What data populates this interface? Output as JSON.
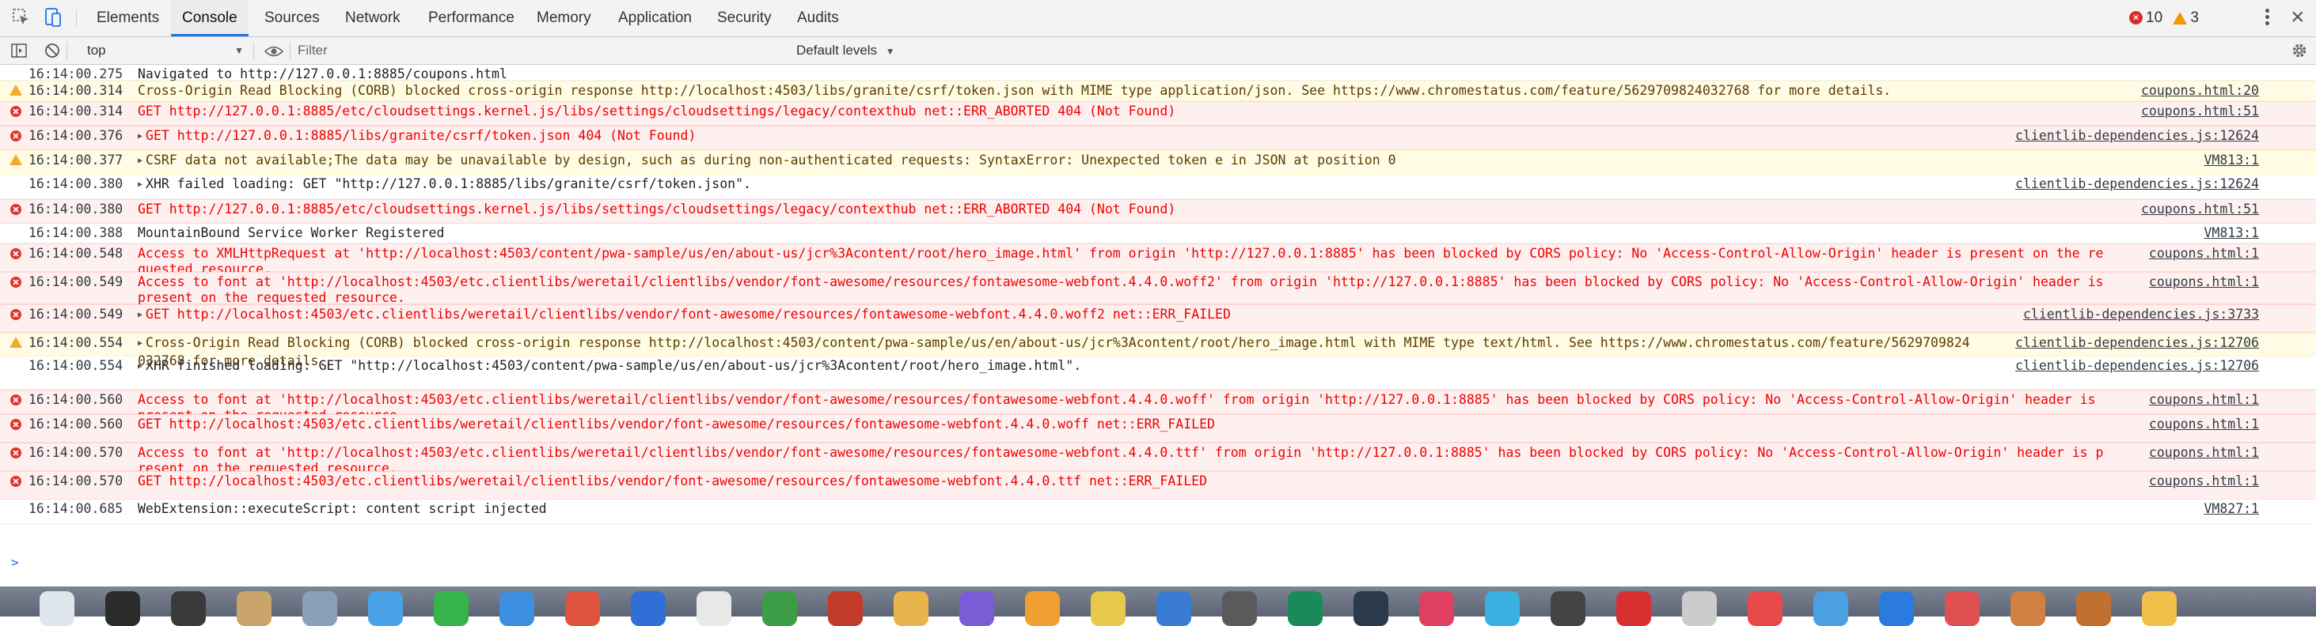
{
  "tabs": [
    {
      "label": "Elements",
      "active": false
    },
    {
      "label": "Console",
      "active": true
    },
    {
      "label": "Sources",
      "active": false
    },
    {
      "label": "Network",
      "active": false
    },
    {
      "label": "Performance",
      "active": false
    },
    {
      "label": "Memory",
      "active": false
    },
    {
      "label": "Application",
      "active": false
    },
    {
      "label": "Security",
      "active": false
    },
    {
      "label": "Audits",
      "active": false
    }
  ],
  "counts": {
    "errors": "10",
    "warnings": "3"
  },
  "toolbar": {
    "context": "top",
    "filter_placeholder": "Filter",
    "levels": "Default levels"
  },
  "messages": [
    {
      "level": "info",
      "time": "16:14:00.275",
      "text": "Navigated to http://127.0.0.1:8885/coupons.html",
      "source": ""
    },
    {
      "level": "warning",
      "time": "16:14:00.314",
      "text": "Cross-Origin Read Blocking (CORB) blocked cross-origin response http://localhost:4503/libs/granite/csrf/token.json with MIME type application/json. See https://www.chromestatus.com/feature/5629709824032768 for more details.",
      "source": "coupons.html:20"
    },
    {
      "level": "error",
      "time": "16:14:00.314",
      "text": "GET http://127.0.0.1:8885/etc/cloudsettings.kernel.js/libs/settings/cloudsettings/legacy/contexthub net::ERR_ABORTED 404 (Not Found)",
      "source": "coupons.html:51"
    },
    {
      "level": "error",
      "time": "16:14:00.376",
      "text": "GET http://127.0.0.1:8885/libs/granite/csrf/token.json 404 (Not Found)",
      "source": "clientlib-dependencies.js:12624",
      "expand": true
    },
    {
      "level": "warning",
      "time": "16:14:00.377",
      "text": "CSRF data not available;The data may be unavailable by design, such as during non-authenticated requests: SyntaxError: Unexpected token e in JSON at position 0",
      "source": "VM813:1",
      "expand": true
    },
    {
      "level": "log",
      "time": "16:14:00.380",
      "text": "XHR failed loading: GET \"http://127.0.0.1:8885/libs/granite/csrf/token.json\".",
      "source": "clientlib-dependencies.js:12624",
      "expand": true
    },
    {
      "level": "error",
      "time": "16:14:00.380",
      "text": "GET http://127.0.0.1:8885/etc/cloudsettings.kernel.js/libs/settings/cloudsettings/legacy/contexthub net::ERR_ABORTED 404 (Not Found)",
      "source": "coupons.html:51"
    },
    {
      "level": "log",
      "time": "16:14:00.388",
      "text": "MountainBound Service Worker Registered",
      "source": "VM813:1"
    },
    {
      "level": "error",
      "time": "16:14:00.548",
      "text": "Access to XMLHttpRequest at 'http://localhost:4503/content/pwa-sample/us/en/about-us/jcr%3Acontent/root/hero_image.html' from origin 'http://127.0.0.1:8885' has been blocked by CORS policy: No 'Access-Control-Allow-Origin' header is present on the requested resource.",
      "source": "coupons.html:1"
    },
    {
      "level": "error",
      "time": "16:14:00.549",
      "text": "Access to font at 'http://localhost:4503/etc.clientlibs/weretail/clientlibs/vendor/font-awesome/resources/fontawesome-webfont.4.4.0.woff2' from origin 'http://127.0.0.1:8885' has been blocked by CORS policy: No 'Access-Control-Allow-Origin' header is present on the requested resource.",
      "source": "coupons.html:1"
    },
    {
      "level": "error",
      "time": "16:14:00.549",
      "text": "GET http://localhost:4503/etc.clientlibs/weretail/clientlibs/vendor/font-awesome/resources/fontawesome-webfont.4.4.0.woff2 net::ERR_FAILED",
      "source": "clientlib-dependencies.js:3733",
      "expand": true
    },
    {
      "level": "warning",
      "time": "16:14:00.554",
      "text": "Cross-Origin Read Blocking (CORB) blocked cross-origin response http://localhost:4503/content/pwa-sample/us/en/about-us/jcr%3Acontent/root/hero_image.html with MIME type text/html. See https://www.chromestatus.com/feature/5629709824032768 for more details.",
      "source": "clientlib-dependencies.js:12706",
      "expand": true
    },
    {
      "level": "log",
      "time": "16:14:00.554",
      "text": "XHR finished loading: GET \"http://localhost:4503/content/pwa-sample/us/en/about-us/jcr%3Acontent/root/hero_image.html\".",
      "source": "clientlib-dependencies.js:12706",
      "expand": true
    },
    {
      "level": "error",
      "time": "16:14:00.560",
      "text": "Access to font at 'http://localhost:4503/etc.clientlibs/weretail/clientlibs/vendor/font-awesome/resources/fontawesome-webfont.4.4.0.woff' from origin 'http://127.0.0.1:8885' has been blocked by CORS policy: No 'Access-Control-Allow-Origin' header is present on the requested resource.",
      "source": "coupons.html:1"
    },
    {
      "level": "error",
      "time": "16:14:00.560",
      "text": "GET http://localhost:4503/etc.clientlibs/weretail/clientlibs/vendor/font-awesome/resources/fontawesome-webfont.4.4.0.woff net::ERR_FAILED",
      "source": "coupons.html:1"
    },
    {
      "level": "error",
      "time": "16:14:00.570",
      "text": "Access to font at 'http://localhost:4503/etc.clientlibs/weretail/clientlibs/vendor/font-awesome/resources/fontawesome-webfont.4.4.0.ttf' from origin 'http://127.0.0.1:8885' has been blocked by CORS policy: No 'Access-Control-Allow-Origin' header is present on the requested resource.",
      "source": "coupons.html:1"
    },
    {
      "level": "error",
      "time": "16:14:00.570",
      "text": "GET http://localhost:4503/etc.clientlibs/weretail/clientlibs/vendor/font-awesome/resources/fontawesome-webfont.4.4.0.ttf net::ERR_FAILED",
      "source": "coupons.html:1"
    },
    {
      "level": "log",
      "time": "16:14:00.685",
      "text": "WebExtension::executeScript: content script injected",
      "source": "VM827:1"
    }
  ],
  "prompt_symbol": ">"
}
